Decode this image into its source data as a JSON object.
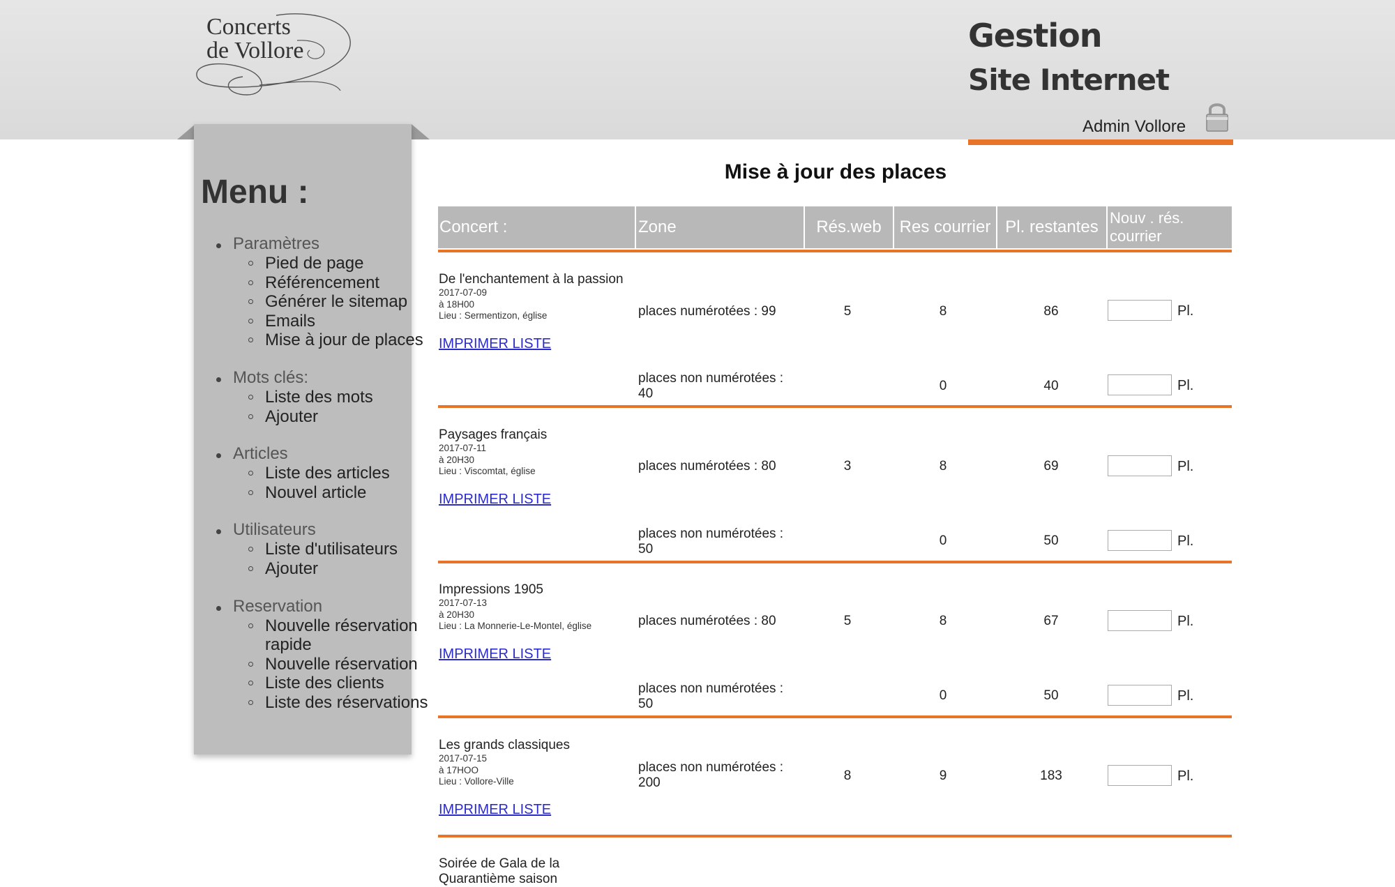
{
  "header": {
    "logo_line1": "Concerts",
    "logo_line2": "de Vollore",
    "title_line1": "Gestion",
    "title_line2": "Site Internet",
    "user": "Admin Vollore",
    "accent_color": "#e8742a"
  },
  "menu": {
    "title": "Menu :",
    "sections": [
      {
        "label": "Paramètres",
        "items": [
          "Pied de page",
          "Référencement",
          "Générer le sitemap",
          "Emails",
          "Mise à jour de places"
        ]
      },
      {
        "label": "Mots clés:",
        "items": [
          "Liste des mots",
          "Ajouter"
        ]
      },
      {
        "label": "Articles",
        "items": [
          "Liste des articles",
          "Nouvel article"
        ]
      },
      {
        "label": "Utilisateurs",
        "items": [
          "Liste d'utilisateurs",
          "Ajouter"
        ]
      },
      {
        "label": "Reservation",
        "items": [
          "Nouvelle réservation",
          "rapide",
          "Nouvelle réservation",
          "Liste des clients",
          "Liste des réservations"
        ]
      }
    ]
  },
  "main": {
    "title": "Mise à jour des places",
    "columns": [
      "Concert :",
      "Zone",
      "Rés.web",
      "Res courrier",
      "Pl. restantes",
      "Nouv . rés.",
      "courrier"
    ],
    "print_label": "IMPRIMER LISTE",
    "pl_suffix": "Pl.",
    "concerts": [
      {
        "title": "De l'enchantement à la passion",
        "date": "2017-07-09",
        "time": "à 18H00",
        "venue": "Lieu : Sermentizon, église",
        "rows": [
          {
            "zone_1": "places numérotées : 99",
            "zone_2": "",
            "web": "5",
            "courrier": "8",
            "restantes": "86"
          },
          {
            "zone_1": "places non numérotées :",
            "zone_2": "40",
            "web": "",
            "courrier": "0",
            "restantes": "40"
          }
        ]
      },
      {
        "title": "Paysages français",
        "date": "2017-07-11",
        "time": "à 20H30",
        "venue": "Lieu : Viscomtat, église",
        "rows": [
          {
            "zone_1": "places numérotées : 80",
            "zone_2": "",
            "web": "3",
            "courrier": "8",
            "restantes": "69"
          },
          {
            "zone_1": "places non numérotées :",
            "zone_2": "50",
            "web": "",
            "courrier": "0",
            "restantes": "50"
          }
        ]
      },
      {
        "title": "Impressions 1905",
        "date": "2017-07-13",
        "time": "à 20H30",
        "venue": "Lieu : La Monnerie-Le-Montel, église",
        "rows": [
          {
            "zone_1": "places numérotées : 80",
            "zone_2": "",
            "web": "5",
            "courrier": "8",
            "restantes": "67"
          },
          {
            "zone_1": "places non numérotées :",
            "zone_2": "50",
            "web": "",
            "courrier": "0",
            "restantes": "50"
          }
        ]
      },
      {
        "title": "Les grands classiques",
        "date": "2017-07-15",
        "time": "à 17HOO",
        "venue": "Lieu : Vollore-Ville",
        "rows": [
          {
            "zone_1": "places non numérotées :",
            "zone_2": "200",
            "web": "8",
            "courrier": "9",
            "restantes": "183"
          }
        ]
      },
      {
        "title_line1": "Soirée de Gala de la",
        "title_line2": "Quarantième saison"
      }
    ]
  }
}
